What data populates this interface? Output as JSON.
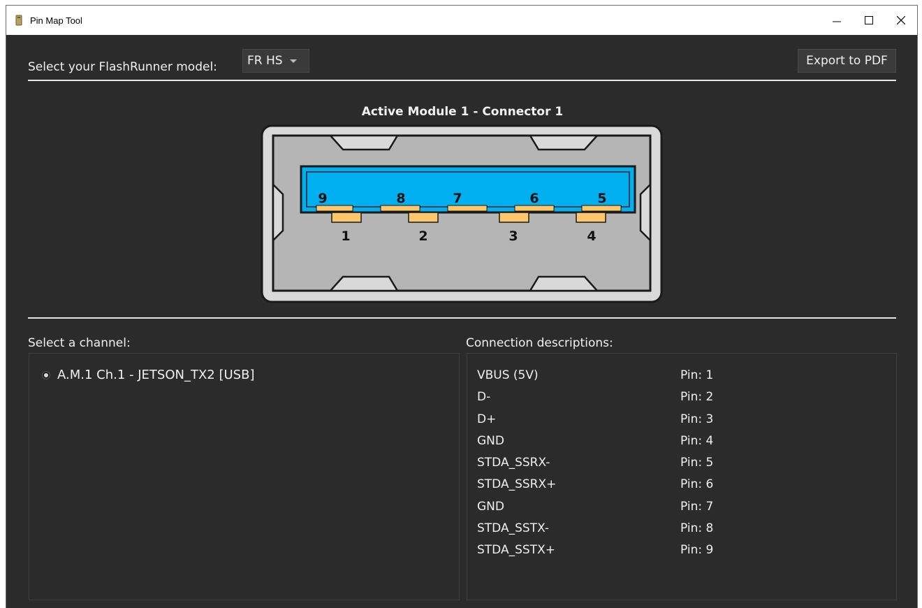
{
  "window": {
    "title": "Pin Map Tool"
  },
  "toolbar": {
    "model_label": "Select your FlashRunner model:",
    "model_value": "FR HS",
    "export_label": "Export to PDF"
  },
  "connector": {
    "title": "Active Module 1 - Connector 1",
    "top_pins": [
      "9",
      "8",
      "7",
      "6",
      "5"
    ],
    "bottom_pins": [
      "1",
      "2",
      "3",
      "4"
    ],
    "colors": {
      "shell": "#d9d9d9",
      "cavity": "#b5b5b5",
      "tongue": "#00b0f0",
      "contact": "#ffc76b"
    }
  },
  "channels": {
    "label": "Select a channel:",
    "items": [
      {
        "label": "A.M.1 Ch.1 - JETSON_TX2 [USB]",
        "selected": true
      }
    ]
  },
  "descriptions": {
    "label": "Connection descriptions:",
    "rows": [
      {
        "name": "VBUS (5V)",
        "pin": "Pin: 1"
      },
      {
        "name": "D-",
        "pin": "Pin: 2"
      },
      {
        "name": "D+",
        "pin": "Pin: 3"
      },
      {
        "name": "GND",
        "pin": "Pin: 4"
      },
      {
        "name": "STDA_SSRX-",
        "pin": "Pin: 5"
      },
      {
        "name": "STDA_SSRX+",
        "pin": "Pin: 6"
      },
      {
        "name": "GND",
        "pin": "Pin: 7"
      },
      {
        "name": "STDA_SSTX-",
        "pin": "Pin: 8"
      },
      {
        "name": "STDA_SSTX+",
        "pin": "Pin: 9"
      }
    ]
  }
}
